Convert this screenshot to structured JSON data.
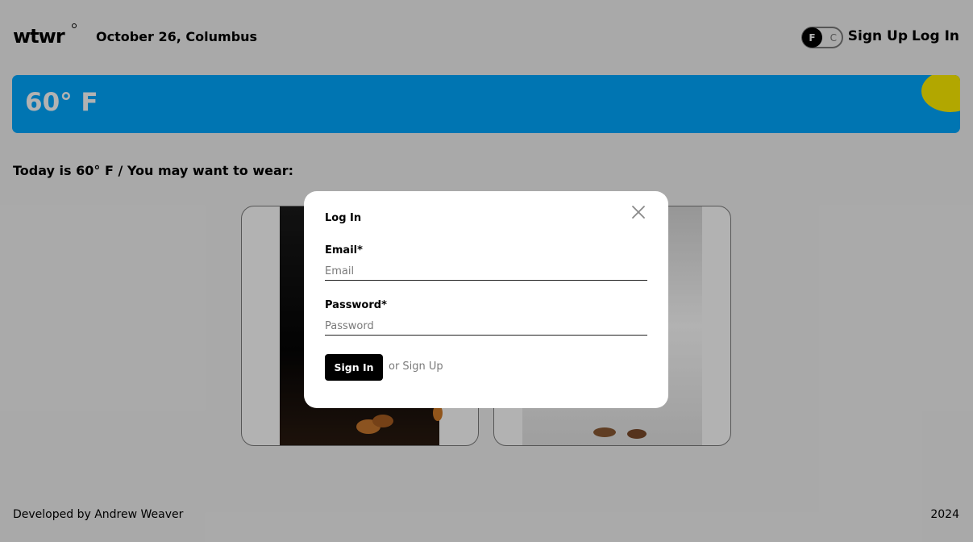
{
  "header": {
    "logo": "wtwr",
    "date_location": "October 26, Columbus",
    "toggle": {
      "f": "F",
      "c": "C",
      "active": "F"
    },
    "nav_signup": "Sign Up",
    "nav_login": "Log In"
  },
  "weather": {
    "temperature": "60° F",
    "card_color": "#00a8ff",
    "sun_color": "#ffef00"
  },
  "main": {
    "wear_text": "Today is 60° F / You may want to wear:"
  },
  "footer": {
    "developer": "Developed by Andrew Weaver",
    "year": "2024"
  },
  "modal": {
    "title": "Log In",
    "email_label": "Email*",
    "email_placeholder": "Email",
    "password_label": "Password*",
    "password_placeholder": "Password",
    "submit_label": "Sign In",
    "alt_link": "or Sign Up",
    "close_icon": "close-icon"
  }
}
